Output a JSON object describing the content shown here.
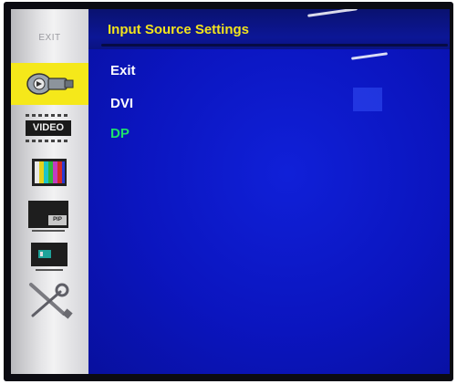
{
  "osd": {
    "title": "Input Source Settings",
    "menu_items": [
      {
        "label": "Exit",
        "selected": false
      },
      {
        "label": "DVI",
        "selected": false
      },
      {
        "label": "DP",
        "selected": true
      }
    ]
  },
  "sidebar": {
    "exit_label": "EXIT",
    "items": [
      {
        "icon": "input-source-icon",
        "active": true
      },
      {
        "icon": "video-icon",
        "label": "VIDEO",
        "active": false
      },
      {
        "icon": "color-bars-icon",
        "active": false
      },
      {
        "icon": "pip-icon",
        "label": "PIP",
        "active": false
      },
      {
        "icon": "display-position-icon",
        "active": false
      },
      {
        "icon": "tools-icon",
        "active": false
      }
    ]
  },
  "colors": {
    "title": "#f2e31c",
    "menu_text": "#ffffff",
    "selected_text": "#1ee26a",
    "active_highlight": "#f5e81a",
    "background": "#0b15bf"
  }
}
